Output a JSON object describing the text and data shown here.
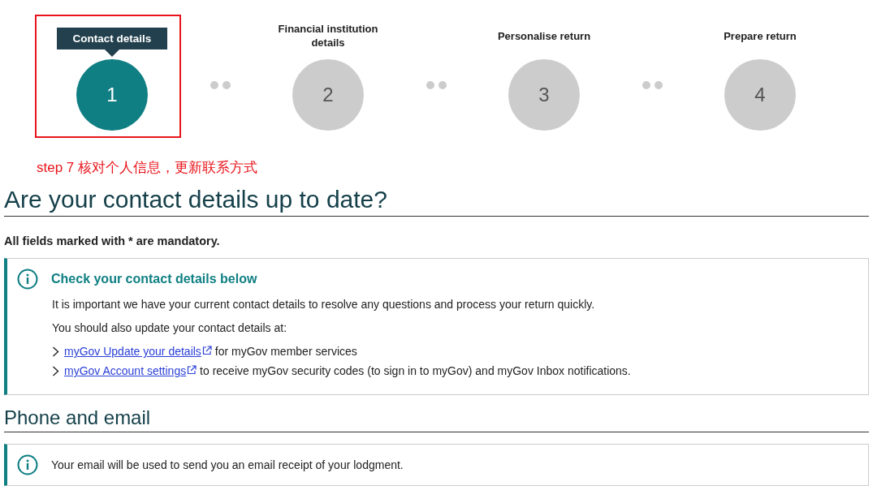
{
  "steps": [
    {
      "number": "1",
      "label": "Contact details",
      "selected": true,
      "highlighted": true
    },
    {
      "number": "2",
      "label": "Financial institution details",
      "selected": false,
      "highlighted": false
    },
    {
      "number": "3",
      "label": "Personalise return",
      "selected": false,
      "highlighted": false
    },
    {
      "number": "4",
      "label": "Prepare return",
      "selected": false,
      "highlighted": false
    }
  ],
  "annotation": "step 7 核对个人信息，更新联系方式",
  "heading": "Are your contact details up to date?",
  "mandatory_note": "All fields marked with * are mandatory.",
  "info_box": {
    "title": "Check your contact details below",
    "paragraphs": [
      "It is important we have your current contact details to resolve any questions and process your return quickly.",
      "You should also update your contact details at:"
    ],
    "links": [
      {
        "link": "myGov Update your details",
        "text": "for myGov member services"
      },
      {
        "link": "myGov Account settings",
        "text": "to receive myGov security codes (to sign in to myGov) and myGov Inbox notifications."
      }
    ]
  },
  "section_heading": "Phone and email",
  "email_note": "Your email will be used to send you an email receipt of your lodgment."
}
